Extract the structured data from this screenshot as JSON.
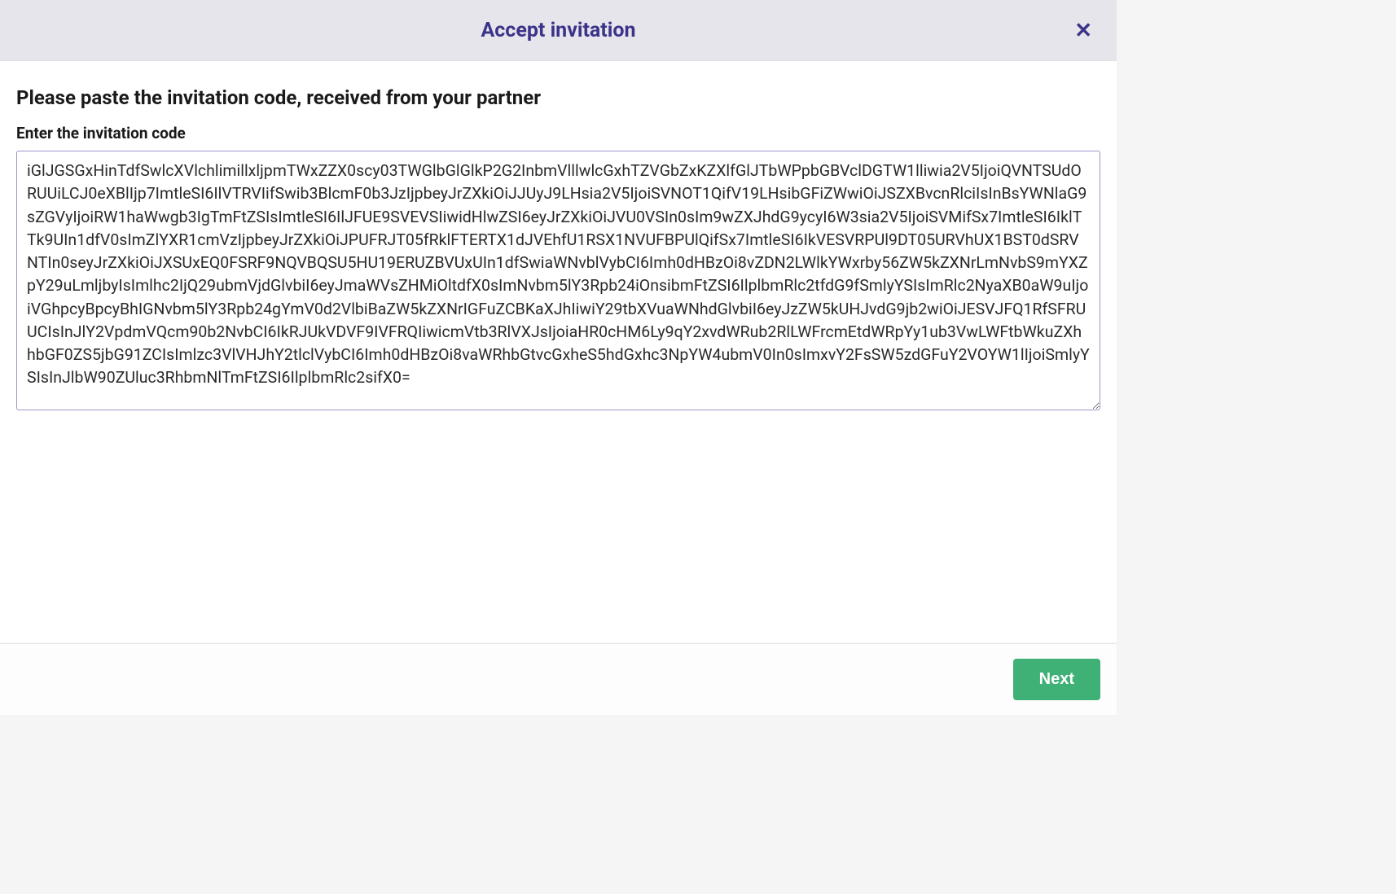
{
  "modal": {
    "title": "Accept invitation",
    "instruction": "Please paste the invitation code, received from your partner",
    "input_label": "Enter the invitation code",
    "code_value": "iGlJGSGxHinTdfSwlcXVlchlimillxljpmTWxZZX0scy03TWGlbGlGlkP2G2InbmVlllwlcGxhTZVGbZxKZXlfGlJTbWPpbGBVclDGTW1lliwia2V5IjoiQVNTSUdORUUiLCJ0eXBlIjp7ImtleSI6IlVTRVIifSwib3BlcmF0b3JzIjpbeyJrZXkiOiJJUyJ9LHsia2V5IjoiSVNOT1QifV19LHsibGFiZWwiOiJSZXBvcnRlciIsInBsYWNlaG9sZGVyIjoiRW1haWwgb3IgTmFtZSIsImtleSI6IlJFUE9SVEVSIiwidHlwZSI6eyJrZXkiOiJVU0VSIn0sIm9wZXJhdG9ycyI6W3sia2V5IjoiSVMifSx7ImtleSI6IklTTk9UIn1dfV0sImZlYXR1cmVzIjpbeyJrZXkiOiJPUFRJT05fRklFTERTX1dJVEhfU1RSX1NVUFBPUlQifSx7ImtleSI6IkVESVRPUl9DT05URVhUX1BST0dSRVNTIn0seyJrZXkiOiJXSUxEQ0FSRF9NQVBQSU5HU19ERUZBVUxUIn1dfSwiaWNvblVybCI6Imh0dHBzOi8vZDN2LWlkYWxrby56ZW5kZXNrLmNvbS9mYXZpY29uLmljbyIsImlhc2IjQ29ubmVjdGlvbiI6eyJmaWVsZHMiOltdfX0sImNvbm5lY3Rpb24iOnsibmFtZSI6IlplbmRlc2tfdG9fSmlyYSIsImRlc2NyaXB0aW9uIjoiVGhpcyBpcyBhIGNvbm5lY3Rpb24gYmV0d2VlbiBaZW5kZXNrIGFuZCBKaXJhIiwiY29tbXVuaWNhdGlvbiI6eyJzZW5kUHJvdG9jb2wiOiJESVJFQ1RfSFRUUCIsInJlY2VpdmVQcm90b2NvbCI6IkRJUkVDVF9IVFRQIiwicmVtb3RlVXJsIjoiaHR0cHM6Ly9qY2xvdWRub2RlLWFrcmEtdWRpYy1ub3VwLWFtbWkuZXhhbGF0ZS5jbG91ZCIsImlzc3VlVHJhY2tlclVybCI6Imh0dHBzOi8vaWRhbGtvcGxheS5hdGxhc3NpYW4ubmV0In0sImxvY2FsSW5zdGFuY2VOYW1lIjoiSmlyYSIsInJlbW90ZUluc3RhbmNlTmFtZSI6IlplbmRlc2sifX0=",
    "next_label": "Next"
  }
}
